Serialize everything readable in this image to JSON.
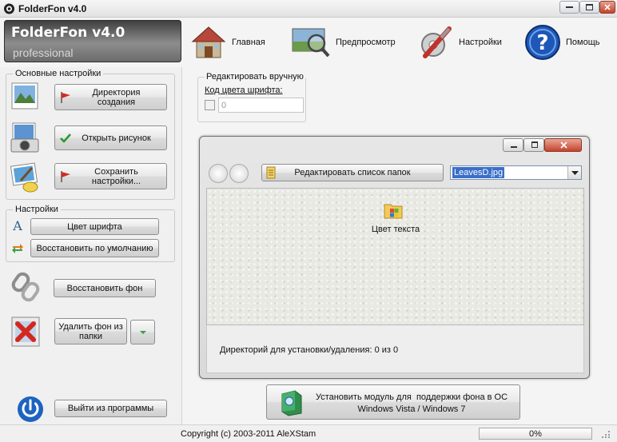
{
  "window": {
    "title": "FolderFon v4.0",
    "controls": [
      "minimize",
      "maximize",
      "close"
    ]
  },
  "header": {
    "logo_title": "FolderFon v4.0",
    "logo_subtitle": "professional",
    "nav": [
      {
        "label": "Главная",
        "icon": "home-icon"
      },
      {
        "label": "Предпросмотр",
        "icon": "preview-magnifier-icon"
      },
      {
        "label": "Настройки",
        "icon": "settings-tools-icon"
      },
      {
        "label": "Помощь",
        "icon": "help-icon"
      }
    ]
  },
  "basic_settings": {
    "title": "Основные настройки",
    "buttons": [
      {
        "label": "Директория создания",
        "icon": "red-flag-icon",
        "side_icon": "landscape-photo-icon"
      },
      {
        "label": "Открыть рисунок",
        "icon": "green-check-icon",
        "side_icon": "camera-photo-icon"
      },
      {
        "label": "Сохранить настройки...",
        "icon": "red-flag-icon",
        "side_icon": "paint-picture-icon"
      }
    ]
  },
  "settings": {
    "title": "Настройки",
    "font_color_label": "Цвет шрифта",
    "restore_default_label": "Восстановить по умолчанию"
  },
  "restore_background_label": "Восстановить фон",
  "delete_background_label": "Удалить фон из папки",
  "exit_label": "Выйти из программы",
  "manual_edit": {
    "title": "Редактировать вручную",
    "color_code_label": "Код цвета шрифта:",
    "color_code_value": "0",
    "checkbox_checked": false
  },
  "preview": {
    "edit_folders_label": "Редактировать список папок",
    "selected_file": "LeavesD.jpg",
    "folder_item_label": "Цвет текста",
    "status_text": "Директорий для установки/удаления: 0 из 0"
  },
  "install_button": {
    "line1": "Установить модуль для  поддержки фона в ОС",
    "line2": "Windows Vista / Windows 7"
  },
  "statusbar": {
    "copyright": "Copyright (c) 2003-2011 AleXStam",
    "progress_text": "0%",
    "progress_fraction": 0
  },
  "colors": {
    "accent_blue": "#3a6fc9",
    "progress_green": "#37b34a",
    "close_red": "#c5432c"
  }
}
